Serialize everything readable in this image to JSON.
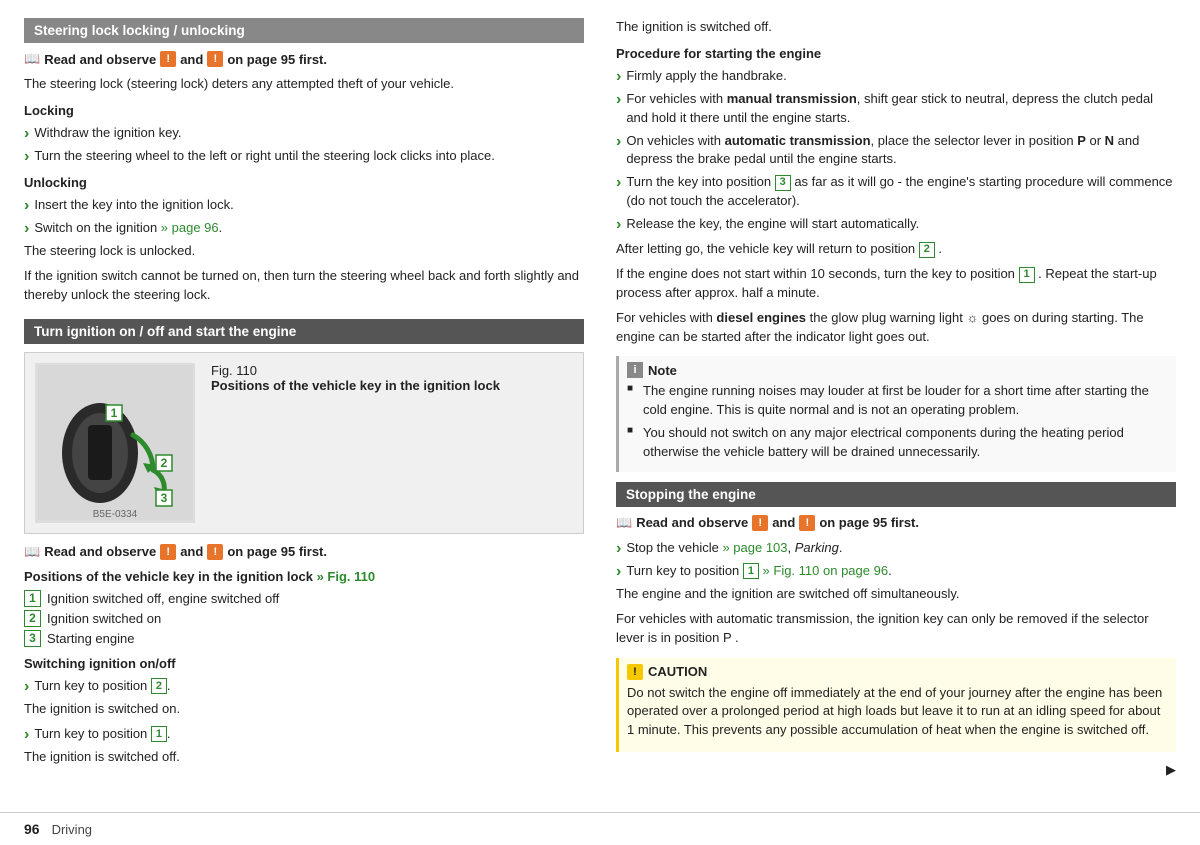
{
  "page": {
    "number": "96",
    "section": "Driving"
  },
  "left_col": {
    "section1": {
      "header": "Steering lock locking / unlocking",
      "read_observe": "Read and observe",
      "and": "and",
      "on_page": "on page 95 first.",
      "intro": "The steering lock (steering lock) deters any attempted theft of your vehicle.",
      "locking_label": "Locking",
      "locking_items": [
        "Withdraw the ignition key.",
        "Turn the steering wheel to the left or right until the steering lock clicks into place."
      ],
      "unlocking_label": "Unlocking",
      "unlocking_items": [
        "Insert the key into the ignition lock.",
        "Switch on the ignition » page 96."
      ],
      "unlocked_text": "The steering lock is unlocked.",
      "cannot_turn_text": "If the ignition switch cannot be turned on, then turn the steering wheel back and forth slightly and thereby unlock the steering lock."
    },
    "section2": {
      "header": "Turn ignition on / off and start the engine",
      "fig_num": "Fig. 110",
      "fig_title": "Positions of the vehicle key in the ignition lock",
      "fig_code": "B5E-0334",
      "read_observe": "Read and observe",
      "and": "and",
      "on_page": "on page 95 first.",
      "positions_label": "Positions of the vehicle key in the ignition lock",
      "positions_link": "» Fig. 110",
      "positions": [
        {
          "num": "1",
          "text": "Ignition switched off, engine switched off"
        },
        {
          "num": "2",
          "text": "Ignition switched on"
        },
        {
          "num": "3",
          "text": "Starting engine"
        }
      ],
      "switching_label": "Switching ignition on/off",
      "switching_items": [
        {
          "text": "Turn key to position",
          "num": "2",
          "suffix": "."
        },
        {
          "text": "",
          "num": "",
          "suffix": ""
        }
      ],
      "ignition_on": "The ignition is switched on.",
      "turn_to_1_prefix": "Turn key to position",
      "turn_to_1_num": "1",
      "turn_to_1_suffix": ".",
      "ignition_off": "The ignition is switched off."
    }
  },
  "right_col": {
    "ignition_off_top": "The ignition is switched off.",
    "procedure_label": "Procedure for starting the engine",
    "procedure_items": [
      "Firmly apply the handbrake.",
      "For vehicles with manual transmission, shift gear stick to neutral, depress the clutch pedal and hold it there until the engine starts.",
      "On vehicles with automatic transmission, place the selector lever in position P or N and depress the brake pedal until the engine starts.",
      "Turn the key into position 3 as far as it will go - the engine's starting procedure will commence (do not touch the accelerator).",
      "Release the key, the engine will start automatically."
    ],
    "after_letting_go": "After letting go, the vehicle key will return to position",
    "after_letting_go_num": "2",
    "after_letting_go_suffix": ".",
    "engine_not_start": "If the engine does not start within 10 seconds, turn the key to position",
    "engine_not_start_num": "1",
    "engine_not_start_suffix": ". Repeat the start-up process after approx. half a minute.",
    "diesel_text": "For vehicles with diesel engines the glow plug warning light",
    "diesel_suffix": "goes on during starting. The engine can be started after the indicator light goes out.",
    "note": {
      "header": "Note",
      "items": [
        "The engine running noises may louder at first be louder for a short time after starting the cold engine. This is quite normal and is not an operating problem.",
        "You should not switch on any major electrical components during the heating period otherwise the vehicle battery will be drained unnecessarily."
      ]
    },
    "section_stopping": {
      "header": "Stopping the engine",
      "read_observe": "Read and observe",
      "and": "and",
      "on_page": "on page 95 first.",
      "items": [
        {
          "text": "Stop the vehicle » page 103, Parking."
        },
        {
          "text": "Turn key to position",
          "num": "1",
          "suffix": " » Fig. 110 on page 96."
        }
      ],
      "engine_ignition_off": "The engine and the ignition are switched off simultaneously.",
      "auto_trans_text": "For vehicles with automatic transmission, the ignition key can only be removed if the selector lever is in position P .",
      "caution_header": "CAUTION",
      "caution_text": "Do not switch the engine off immediately at the end of your journey after the engine has been operated over a prolonged period at high loads but leave it to run at an idling speed for about 1 minute. This prevents any possible accumulation of heat when the engine is switched off."
    }
  }
}
